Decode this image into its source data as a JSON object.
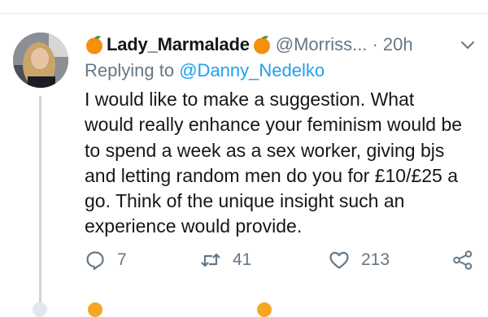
{
  "tweet": {
    "display_name": "Lady_Marmalade",
    "name_emoji_icon": "orange-emoji-icon",
    "handle": "@Morriss...",
    "separator": "·",
    "time": "20h",
    "replying_prefix": "Replying to ",
    "replying_to": "@Danny_Nedelko",
    "text": "I would like to make a suggestion.  What\nwould really enhance your feminism would be\nto spend a week as a sex worker, giving bjs\nand letting random men do you for £10/£25 a\ngo. Think of the unique insight such an\nexperience would provide."
  },
  "actions": {
    "reply_count": "7",
    "retweet_count": "41",
    "like_count": "213"
  },
  "colors": {
    "secondary_text": "#657786",
    "link": "#1da1f2",
    "divider": "#e6ecf0",
    "orange": "#f5a623"
  }
}
